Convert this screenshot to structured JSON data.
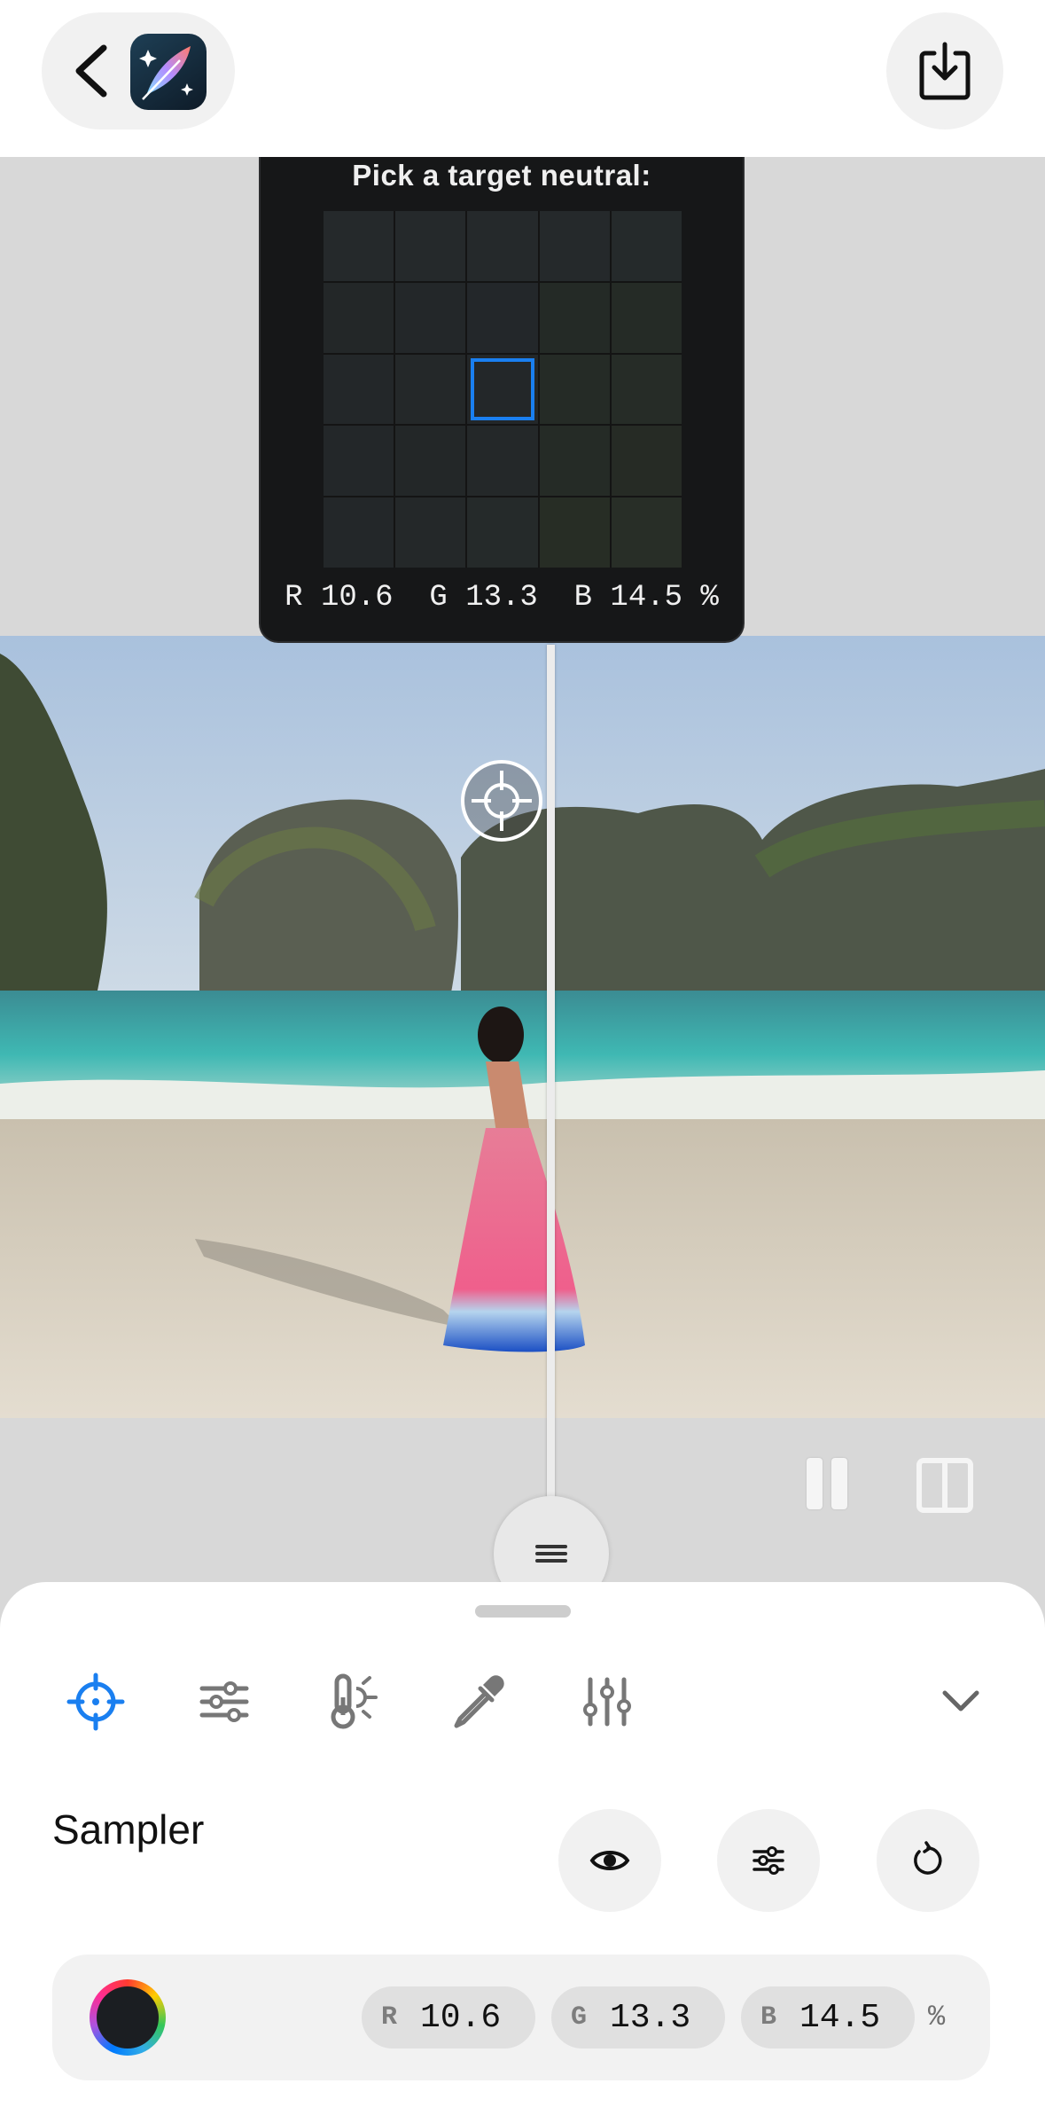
{
  "header": {
    "back_icon": "chevron-left-icon",
    "app_icon": "feather-sparkle-icon",
    "save_icon": "download-tray-icon"
  },
  "loupe": {
    "title": "Pick a target neutral:",
    "swatches": [
      [
        "#25292b",
        "#25292b",
        "#25292b",
        "#25292b",
        "#252a2b"
      ],
      [
        "#232728",
        "#232729",
        "#23272a",
        "#242a26",
        "#252b26"
      ],
      [
        "#232729",
        "#242829",
        "#232729",
        "#252b26",
        "#262c27"
      ],
      [
        "#232729",
        "#232728",
        "#242829",
        "#252b26",
        "#262b25"
      ],
      [
        "#232729",
        "#242829",
        "#252a2a",
        "#272d25",
        "#282e27"
      ]
    ],
    "selected_row": 2,
    "selected_col": 2,
    "values_text": "R 10.6  G 13.3  B 14.5 %"
  },
  "colors": {
    "accent": "#1a7ff0",
    "loupe_bg": "#161718",
    "sheet_bg": "#ffffff",
    "canvas_bg": "#d8d8d8"
  },
  "tools": {
    "items": [
      {
        "icon": "crosshair-icon",
        "active": true
      },
      {
        "icon": "sliders-horizontal-icon",
        "active": false
      },
      {
        "icon": "thermometer-sun-icon",
        "active": false
      },
      {
        "icon": "eyedropper-icon",
        "active": false
      },
      {
        "icon": "sliders-vertical-icon",
        "active": false
      }
    ],
    "collapse_icon": "chevron-down-icon"
  },
  "sampler": {
    "title": "Sampler",
    "buttons": [
      "eye-icon",
      "sliders-icon",
      "reset-icon"
    ],
    "r_label": "R",
    "r_value": "10.6",
    "g_label": "G",
    "g_value": "13.3",
    "b_label": "B",
    "b_value": "14.5",
    "unit": "%"
  }
}
